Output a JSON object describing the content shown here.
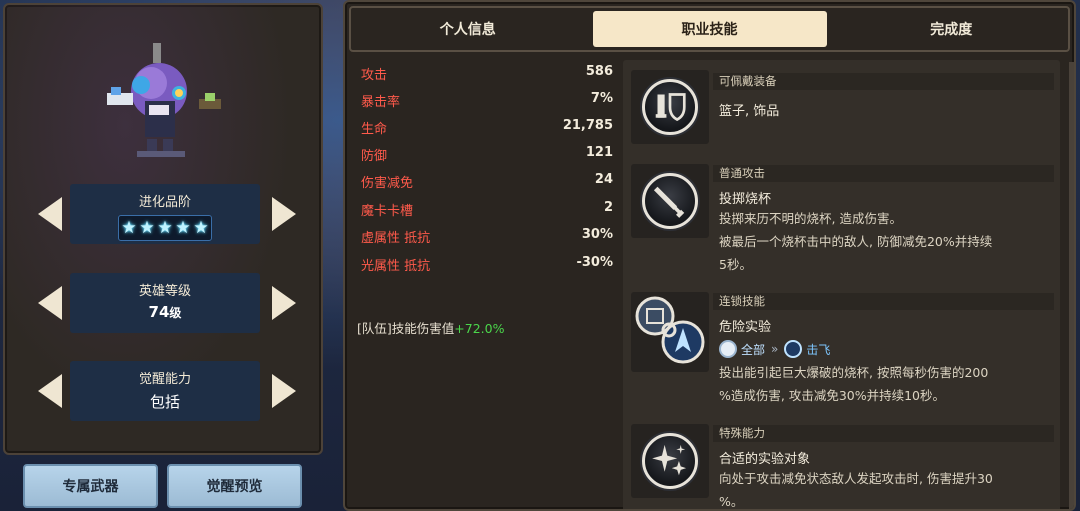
{
  "left": {
    "evolution": {
      "label": "进化品阶",
      "stars": 5
    },
    "hero_level": {
      "label": "英雄等级",
      "value": "74",
      "unit": "级"
    },
    "awakening": {
      "label": "觉醒能力",
      "value": "包括"
    },
    "buttons": {
      "weapon": "专属武器",
      "preview": "觉醒预览"
    }
  },
  "tabs": [
    {
      "label": "个人信息",
      "active": false
    },
    {
      "label": "职业技能",
      "active": true
    },
    {
      "label": "完成度",
      "active": false
    }
  ],
  "stats": [
    {
      "name": "攻击",
      "value": "586"
    },
    {
      "name": "暴击率",
      "value": "7%"
    },
    {
      "name": "生命",
      "value": "21,785"
    },
    {
      "name": "防御",
      "value": "121"
    },
    {
      "name": "伤害减免",
      "value": "24"
    },
    {
      "name": "魔卡卡槽",
      "value": "2"
    },
    {
      "name": "虚属性 抵抗",
      "value": "30%"
    },
    {
      "name": "光属性 抵抗",
      "value": "-30%"
    }
  ],
  "team_bonus": {
    "text": "[队伍]技能伤害值",
    "plus": "+72.0%"
  },
  "skills": {
    "equip": {
      "category": "可佩戴装备",
      "title": "篮子, 饰品"
    },
    "normal": {
      "category": "普通攻击",
      "title": "投掷烧杯",
      "desc1": "投掷来历不明的烧杯, 造成伤害。",
      "desc2": "被最后一个烧杯击中的敌人, 防御减免20%并持续",
      "desc3": "5秒。"
    },
    "chain": {
      "category": "连锁技能",
      "title": "危险实验",
      "tag_from": "全部",
      "tag_sep": "»",
      "tag_to": "击飞",
      "desc1": "投出能引起巨大爆破的烧杯, 按照每秒伤害的200",
      "desc2": "%造成伤害, 攻击减免30%并持续10秒。"
    },
    "special": {
      "category": "特殊能力",
      "title": "合适的实验对象",
      "desc1": "向处于攻击减免状态敌人发起攻击时, 伤害提升30",
      "desc2": "%。"
    }
  },
  "colors": {
    "stat_name": "#ff5a4b",
    "bonus_plus": "#4bd64b",
    "active_tab": "#f6e7c8",
    "button_bg": "#b7d4ea"
  }
}
